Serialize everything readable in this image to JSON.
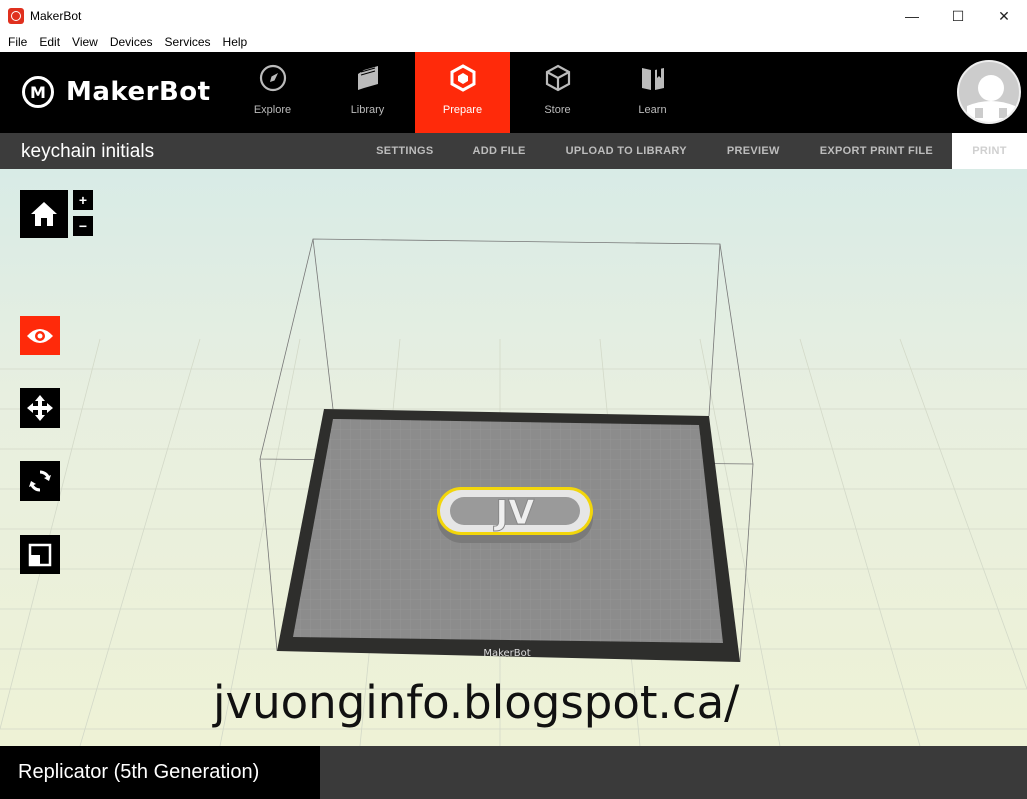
{
  "window": {
    "title": "MakerBot",
    "minimize": "—",
    "maximize": "☐",
    "close": "✕"
  },
  "menu": [
    "File",
    "Edit",
    "View",
    "Devices",
    "Services",
    "Help"
  ],
  "brand": {
    "logo_mark": "M",
    "logo_text": "MakerBot"
  },
  "nav": [
    {
      "label": "Explore",
      "icon": "compass-icon"
    },
    {
      "label": "Library",
      "icon": "library-icon"
    },
    {
      "label": "Prepare",
      "icon": "prepare-icon",
      "active": true
    },
    {
      "label": "Store",
      "icon": "store-icon"
    },
    {
      "label": "Learn",
      "icon": "learn-icon"
    }
  ],
  "project": {
    "title": "keychain initials"
  },
  "actions": {
    "settings": "SETTINGS",
    "add_file": "ADD FILE",
    "upload": "UPLOAD TO LIBRARY",
    "preview": "PREVIEW",
    "export": "EXPORT PRINT FILE",
    "print": "PRINT"
  },
  "zoom": {
    "in": "+",
    "out": "−"
  },
  "tools": [
    "home-icon",
    "eye-icon",
    "move-icon",
    "rotate-icon",
    "scale-icon"
  ],
  "model": {
    "initials": "JV"
  },
  "plate_label": "MakerBot",
  "watermark": "jvuonginfo.blogspot.ca/",
  "printer": "Replicator (5th Generation)",
  "colors": {
    "accent": "#ff2a0a",
    "header": "#000000",
    "subbar": "#3c3c3c",
    "selection": "#f2d60b"
  }
}
